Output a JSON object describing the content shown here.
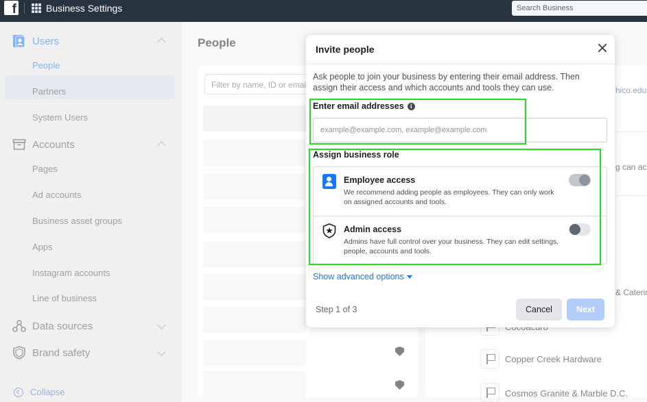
{
  "topbar": {
    "app_title": "Business Settings",
    "search_placeholder": "Search Business"
  },
  "sidebar": {
    "users_label": "Users",
    "users_items": [
      "People",
      "Partners",
      "System Users"
    ],
    "accounts_label": "Accounts",
    "accounts_items": [
      "Pages",
      "Ad accounts",
      "Business asset groups",
      "Apps",
      "Instagram accounts",
      "Line of business"
    ],
    "data_sources_label": "Data sources",
    "brand_safety_label": "Brand safety",
    "collapse_label": "Collapse"
  },
  "main": {
    "title": "People",
    "filter_placeholder": "Filter by name, ID or email",
    "right_partials": {
      "email_fragment": "hico.edu",
      "access_fragment": "g can ac",
      "catering_fragment": "& Caterin"
    },
    "businesses": [
      "Cocoacuro",
      "Copper Creek Hardware",
      "Cosmos Granite & Marble D.C."
    ]
  },
  "modal": {
    "title": "Invite people",
    "description": "Ask people to join your business by entering their email address. Then assign their access and which accounts and tools they can use.",
    "email_label": "Enter email addresses",
    "email_placeholder": "example@example.com, example@example.com",
    "role_label": "Assign business role",
    "roles": [
      {
        "title": "Employee access",
        "description": "We recommend adding people as employees. They can only work on assigned accounts and tools.",
        "enabled": true
      },
      {
        "title": "Admin access",
        "description": "Admins have full control over your business. They can edit settings, people, accounts and tools.",
        "enabled": false
      }
    ],
    "advanced_label": "Show advanced options",
    "step_text": "Step 1 of 3",
    "cancel_label": "Cancel",
    "next_label": "Next"
  },
  "colors": {
    "topbar": "#283340",
    "accent": "#1877f2",
    "highlight": "#22e01e"
  }
}
